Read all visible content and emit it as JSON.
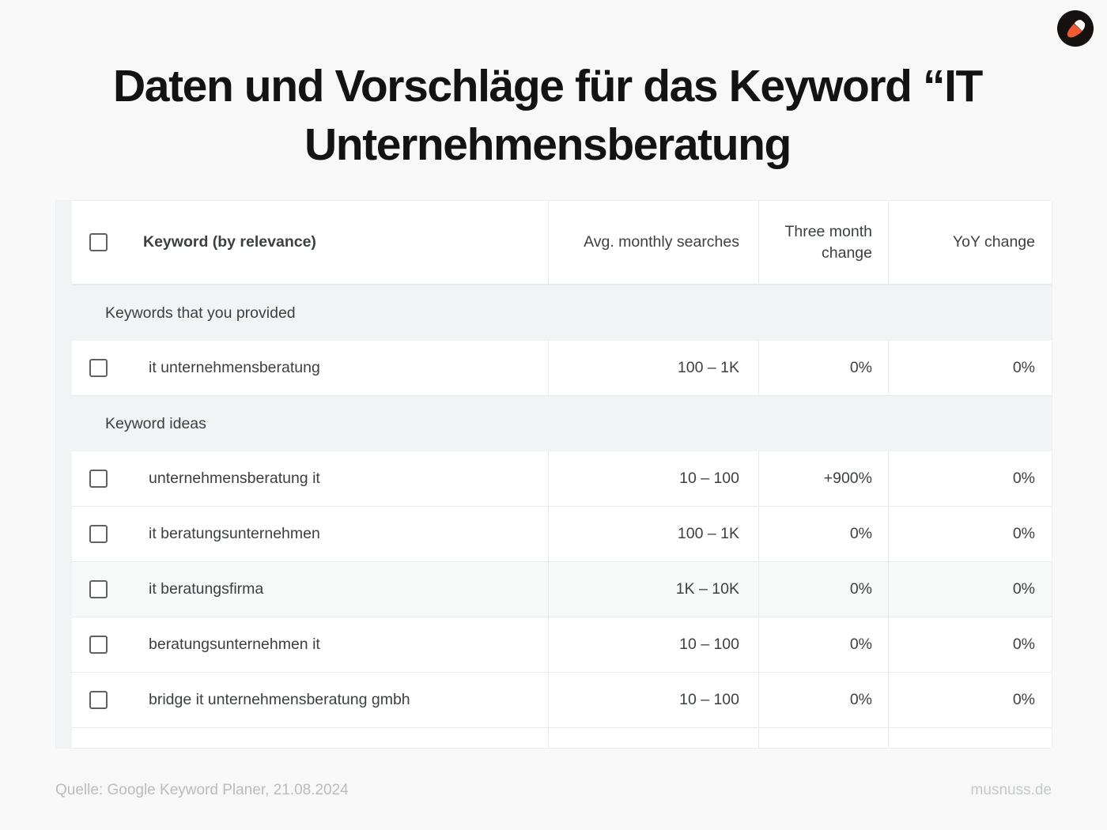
{
  "brand": {
    "logo_icon": "acorn-logo-icon",
    "logo_circle_color": "#14110f",
    "logo_nut_color": "#ee5a32",
    "logo_highlight_color": "#ffffff"
  },
  "title": "Daten und Vorschläge für das Keyword “IT Unternehmensberatung",
  "table": {
    "columns": [
      {
        "key": "keyword",
        "label": "Keyword (by relevance)"
      },
      {
        "key": "searches",
        "label": "Avg. monthly searches"
      },
      {
        "key": "three",
        "label": "Three month change"
      },
      {
        "key": "yoy",
        "label": "YoY change"
      }
    ],
    "select_all_checkbox": "unchecked",
    "groups": [
      {
        "label": "Keywords that you provided",
        "rows": [
          {
            "keyword": "it unternehmensberatung",
            "searches": "100 – 1K",
            "three": "0%",
            "yoy": "0%",
            "checked": false,
            "highlight": false
          }
        ]
      },
      {
        "label": "Keyword ideas",
        "rows": [
          {
            "keyword": "unternehmensberatung it",
            "searches": "10 – 100",
            "three": "+900%",
            "yoy": "0%",
            "checked": false,
            "highlight": false
          },
          {
            "keyword": "it beratungsunternehmen",
            "searches": "100 – 1K",
            "three": "0%",
            "yoy": "0%",
            "checked": false,
            "highlight": false
          },
          {
            "keyword": "it beratungsfirma",
            "searches": "1K – 10K",
            "three": "0%",
            "yoy": "0%",
            "checked": false,
            "highlight": true
          },
          {
            "keyword": "beratungsunternehmen it",
            "searches": "10 – 100",
            "three": "0%",
            "yoy": "0%",
            "checked": false,
            "highlight": false
          },
          {
            "keyword": "bridge it unternehmensberatung gmbh",
            "searches": "10 – 100",
            "three": "0%",
            "yoy": "0%",
            "checked": false,
            "highlight": false
          }
        ]
      }
    ]
  },
  "footer": {
    "source": "Quelle: Google Keyword Planer, 21.08.2024",
    "site": "musnuss.de"
  }
}
